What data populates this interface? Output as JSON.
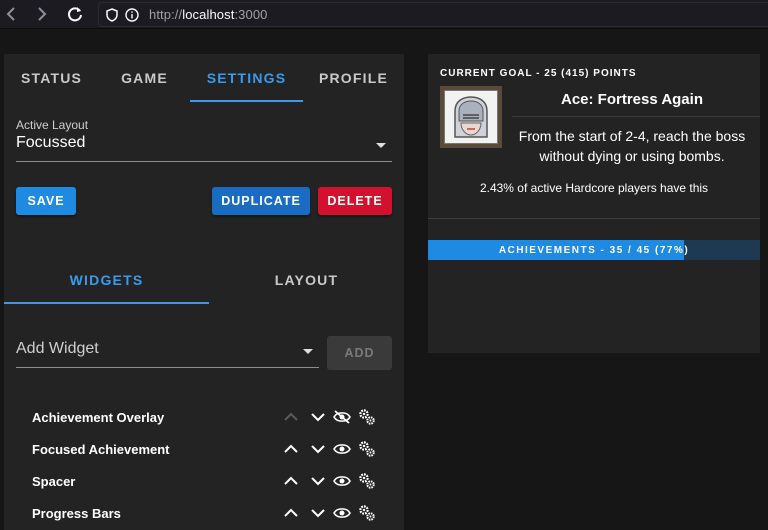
{
  "browser": {
    "url_protocol": "http://",
    "url_host": "localhost",
    "url_port": ":3000"
  },
  "tabs": [
    {
      "label": "STATUS",
      "active": false
    },
    {
      "label": "GAME",
      "active": false
    },
    {
      "label": "SETTINGS",
      "active": true
    },
    {
      "label": "PROFILE",
      "active": false
    }
  ],
  "layout_selector": {
    "label": "Active Layout",
    "value": "Focussed"
  },
  "actions": {
    "save": "SAVE",
    "duplicate": "DUPLICATE",
    "delete": "DELETE"
  },
  "subtabs": [
    {
      "label": "WIDGETS",
      "active": true
    },
    {
      "label": "LAYOUT",
      "active": false
    }
  ],
  "add_widget": {
    "placeholder": "Add Widget",
    "button": "ADD"
  },
  "widgets": [
    {
      "name": "Achievement Overlay",
      "up_enabled": false,
      "visible": false
    },
    {
      "name": "Focused Achievement",
      "up_enabled": true,
      "visible": true
    },
    {
      "name": "Spacer",
      "up_enabled": true,
      "visible": true
    },
    {
      "name": "Progress Bars",
      "up_enabled": true,
      "visible": true
    }
  ],
  "goal": {
    "label": "CURRENT GOAL - 25 (415) POINTS",
    "title": "Ace: Fortress Again",
    "description": "From the start of 2-4, reach the boss without dying or using bombs.",
    "rarity": "2.43% of active Hardcore players have this"
  },
  "achievements_progress": {
    "text": "ACHIEVEMENTS - 35 / 45 (77%)",
    "fraction": 0.77
  },
  "colors": {
    "accent": "#3b9aeb",
    "save": "#1f8ae2",
    "duplicate": "#1a6cc2",
    "delete": "#d3102d"
  }
}
